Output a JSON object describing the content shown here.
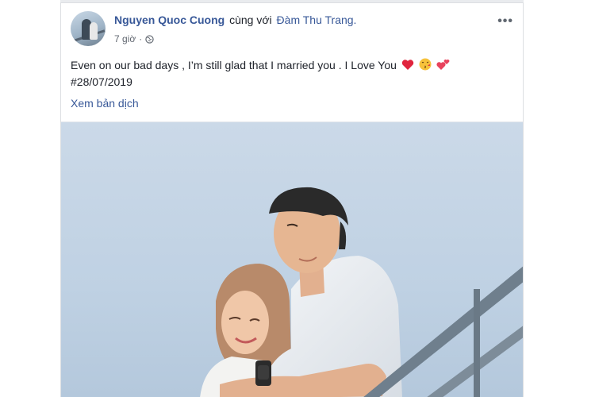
{
  "post": {
    "author": "Nguyen Quoc Cuong",
    "with_word": "cùng với",
    "tagged": "Đàm Thu Trang.",
    "time": "7 giờ",
    "privacy_icon": "globe-icon",
    "more_icon": "more-options-icon",
    "more_label": "•••",
    "text_line1": "Even on our bad days , I’m still glad that I married you . I Love You",
    "emojis": [
      "red-heart-emoji",
      "kissing-face-emoji",
      "two-hearts-emoji"
    ],
    "text_line2": "#28/07/2019",
    "translate_label": "Xem bản dịch"
  },
  "photo": {
    "subject": "couple-on-railing-photo"
  },
  "colors": {
    "link": "#385898",
    "text": "#1d2129",
    "muted": "#616770",
    "sky": "#c4d5e6"
  }
}
